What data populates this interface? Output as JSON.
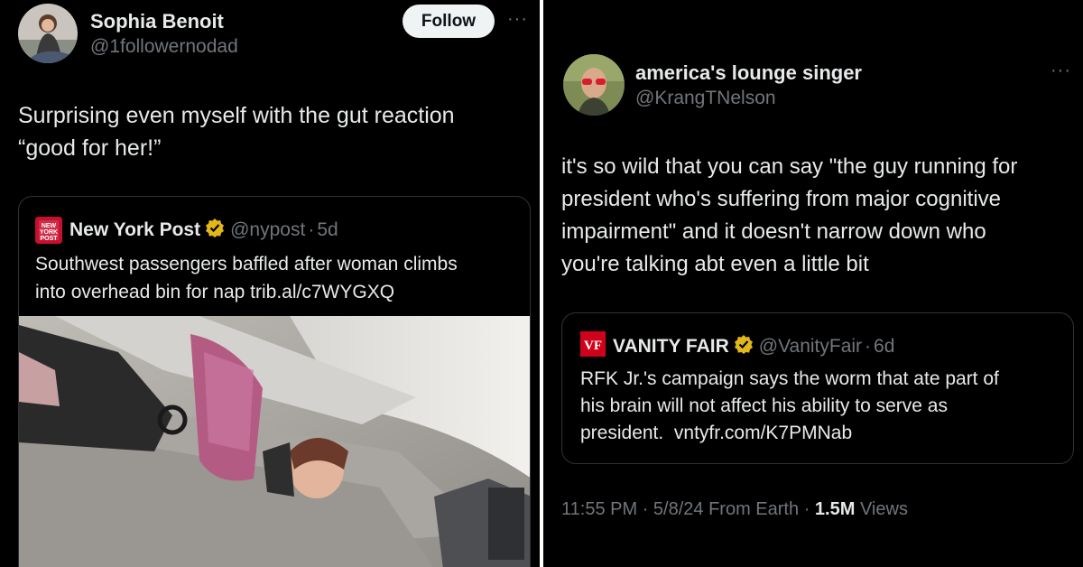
{
  "left_tweet": {
    "author_name": "Sophia Benoit",
    "author_handle": "@1followernodad",
    "follow_label": "Follow",
    "more_label": "···",
    "text_line1": "Surprising even myself with the gut reaction",
    "text_line2": "“good for her!”",
    "quote": {
      "logo_text": "NEW YORK POST",
      "name": "New York Post",
      "handle": "@nypost",
      "separator": "·",
      "time": "5d",
      "text_line1": "Southwest passengers baffled after woman climbs",
      "text_line2": "into overhead bin for nap trib.al/c7WYGXQ"
    }
  },
  "right_tweet": {
    "author_name": "america's lounge singer",
    "author_handle": "@KrangTNelson",
    "more_label": "···",
    "text_lines": [
      "it's so wild that you can say \"the guy running for",
      "president who's suffering from major cognitive",
      "impairment\" and it doesn't narrow down who",
      "you're talking abt even a little bit"
    ],
    "quote": {
      "logo_text": "VF",
      "name": "VANITY FAIR",
      "handle": "@VanityFair",
      "separator": "·",
      "time": "6d",
      "text_lines": [
        "RFK Jr.'s campaign says the worm that ate part of",
        "his brain will not affect his ability to serve as",
        "president.  vntyfr.com/K7PMNab"
      ]
    },
    "meta": {
      "time": "11:55 PM",
      "sep1": "·",
      "date": "5/8/24",
      "source": "From Earth",
      "sep2": "·",
      "views_count": "1.5M",
      "views_label": "Views"
    }
  },
  "colors": {
    "background": "#000000",
    "text_primary": "#e7e9ea",
    "text_secondary": "#71767b",
    "card_border": "#2f3336",
    "verified_gold": "#e2b719",
    "nypost_red": "#c8102e",
    "vf_red": "#d0021b"
  },
  "icons": [
    "verified-gold-badge-icon",
    "more-options-icon"
  ]
}
